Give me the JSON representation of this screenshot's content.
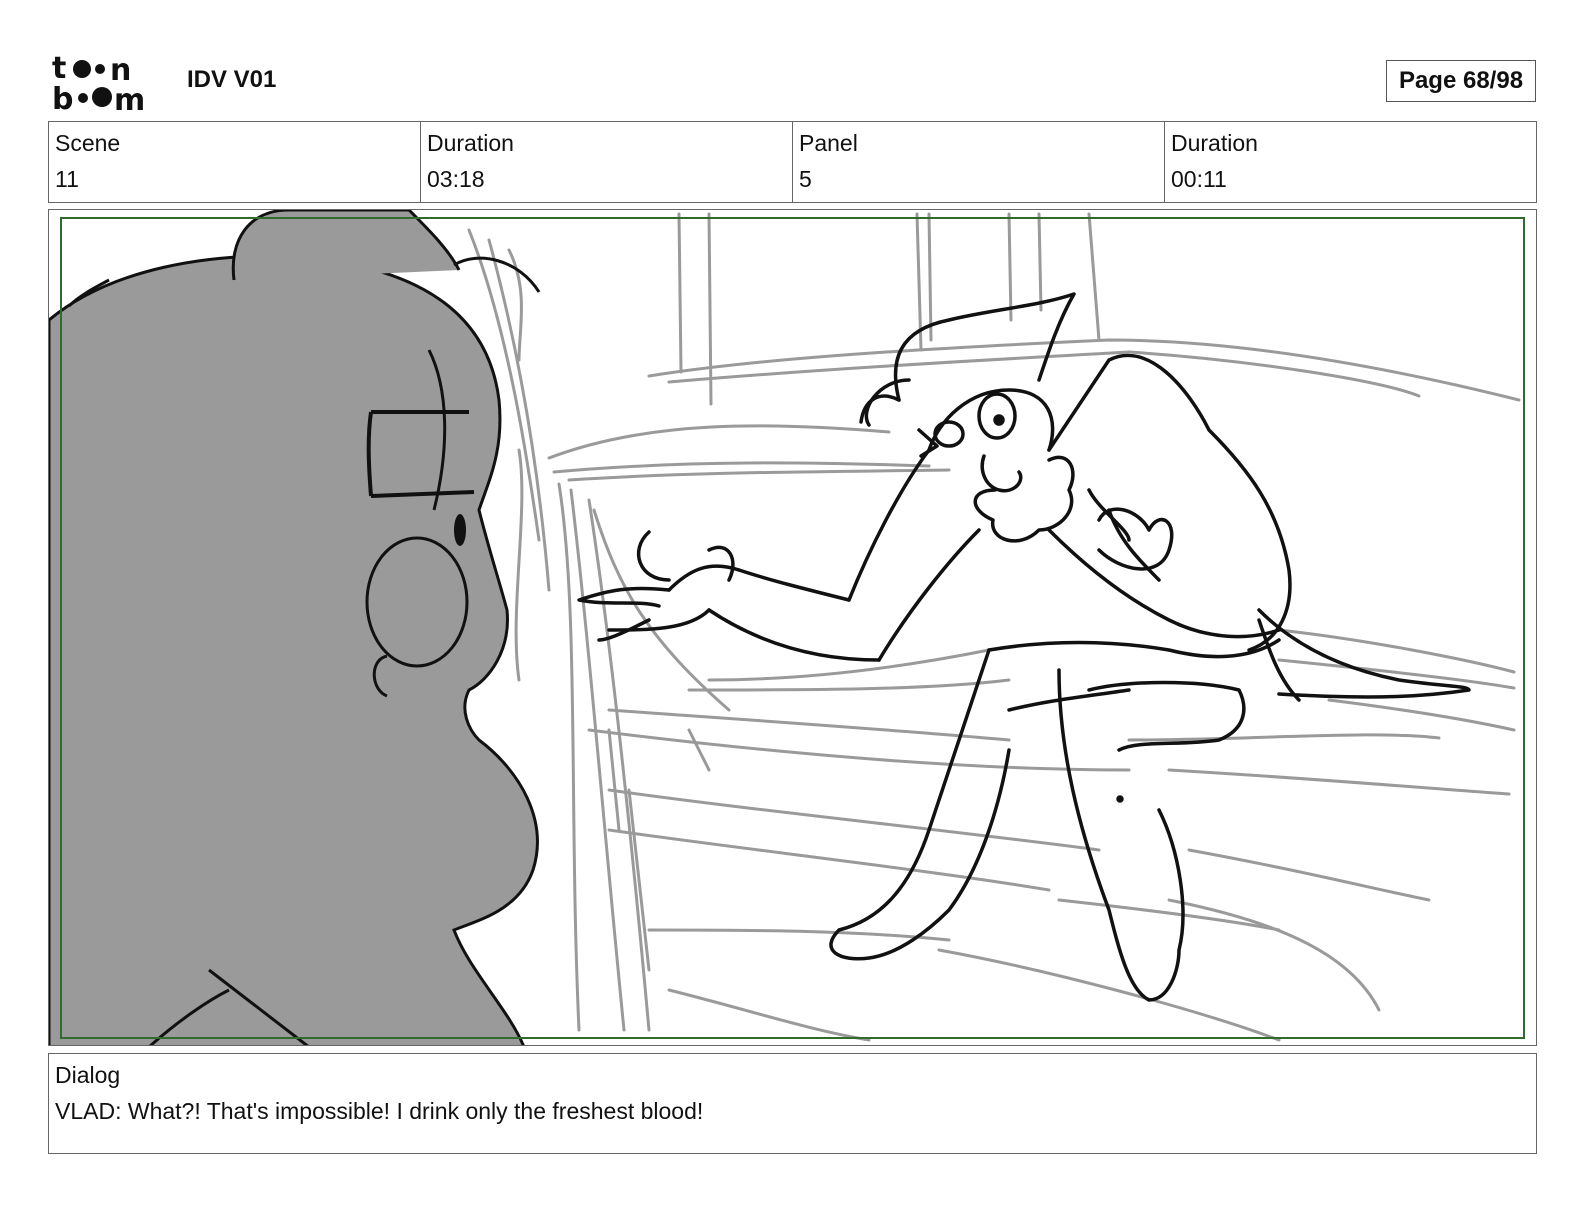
{
  "header": {
    "logo_name": "toonboom-logo",
    "logo_text": "toon boom",
    "title": "IDV V01",
    "page_label": "Page 68/98"
  },
  "info": {
    "scene_label": "Scene",
    "scene_value": "11",
    "scene_duration_label": "Duration",
    "scene_duration_value": "03:18",
    "panel_label": "Panel",
    "panel_value": "5",
    "panel_duration_label": "Duration",
    "panel_duration_value": "00:11"
  },
  "panel": {
    "image_name": "storyboard-sketch",
    "safe_frame_color": "#2f6b2f",
    "silhouette_color": "#9a9a9a",
    "background_sketch_color": "#9a9a9a",
    "ink_color": "#111111"
  },
  "dialog": {
    "label": "Dialog",
    "text": "VLAD: What?! That's impossible! I drink only the freshest blood!"
  }
}
